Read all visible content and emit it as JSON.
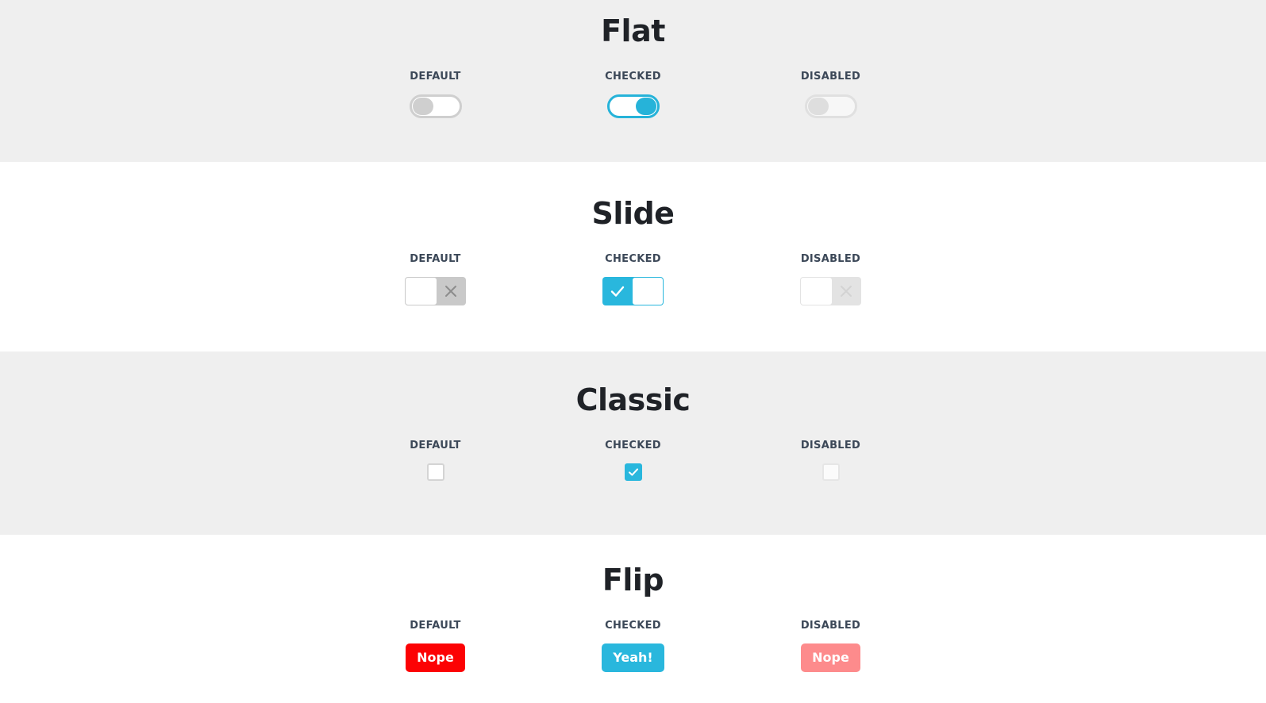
{
  "colors": {
    "accent_cyan": "#29b7dd",
    "danger_red": "#fc0204",
    "danger_red_disabled": "#fd8b8c",
    "section_gray_bg": "#efefef",
    "section_white_bg": "#ffffff",
    "label_text": "#3c4858",
    "heading_text": "#1f2227",
    "toggle_gray": "#cfcfcf"
  },
  "state_labels": {
    "default": "DEFAULT",
    "checked": "CHECKED",
    "disabled": "DISABLED"
  },
  "sections": [
    {
      "id": "flat",
      "title": "Flat",
      "background": "gray",
      "items": [
        {
          "state": "default",
          "label": "DEFAULT",
          "checked": false,
          "disabled": false
        },
        {
          "state": "checked",
          "label": "CHECKED",
          "checked": true,
          "disabled": false
        },
        {
          "state": "disabled",
          "label": "DISABLED",
          "checked": false,
          "disabled": true
        }
      ]
    },
    {
      "id": "slide",
      "title": "Slide",
      "background": "white",
      "on_icon": "check-icon",
      "off_icon": "cross-icon",
      "items": [
        {
          "state": "default",
          "label": "DEFAULT",
          "checked": false,
          "disabled": false
        },
        {
          "state": "checked",
          "label": "CHECKED",
          "checked": true,
          "disabled": false
        },
        {
          "state": "disabled",
          "label": "DISABLED",
          "checked": false,
          "disabled": true
        }
      ]
    },
    {
      "id": "classic",
      "title": "Classic",
      "background": "gray",
      "on_icon": "check-icon",
      "items": [
        {
          "state": "default",
          "label": "DEFAULT",
          "checked": false,
          "disabled": false
        },
        {
          "state": "checked",
          "label": "CHECKED",
          "checked": true,
          "disabled": false
        },
        {
          "state": "disabled",
          "label": "DISABLED",
          "checked": false,
          "disabled": true
        }
      ]
    },
    {
      "id": "flip",
      "title": "Flip",
      "background": "white",
      "items": [
        {
          "state": "default",
          "label": "DEFAULT",
          "text": "Nope",
          "checked": false,
          "disabled": false
        },
        {
          "state": "checked",
          "label": "CHECKED",
          "text": "Yeah!",
          "checked": true,
          "disabled": false
        },
        {
          "state": "disabled",
          "label": "DISABLED",
          "text": "Nope",
          "checked": false,
          "disabled": true
        }
      ]
    }
  ]
}
